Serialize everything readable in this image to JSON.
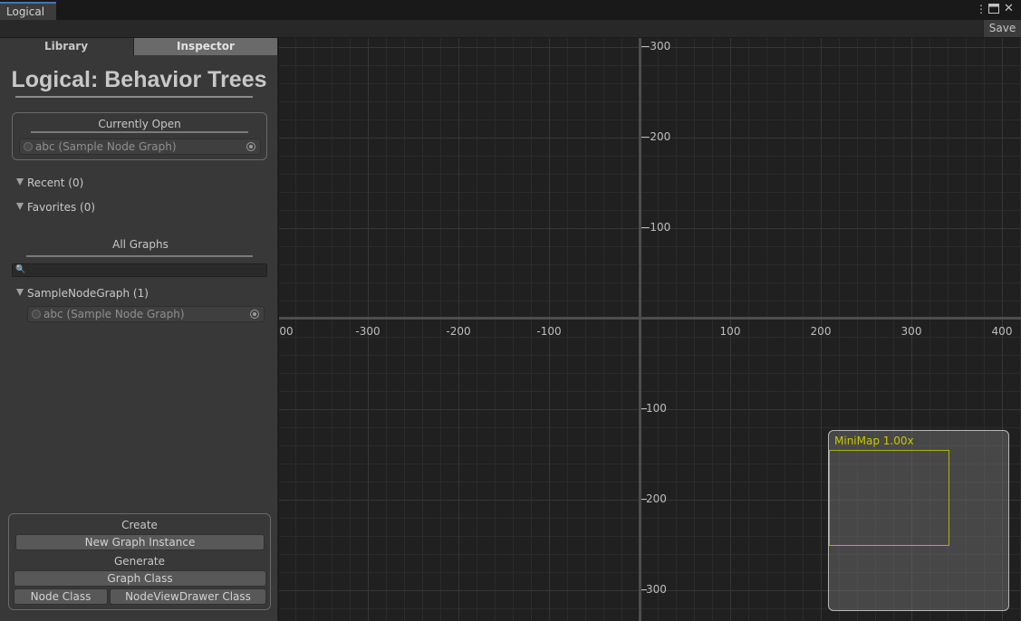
{
  "window": {
    "tab_title": "Logical",
    "menu_icon": "kebab-icon",
    "maximize_icon": "maximize-icon",
    "close_icon": "close-icon"
  },
  "toolbar": {
    "save_label": "Save"
  },
  "sidebar": {
    "tabs": [
      {
        "label": "Library",
        "active": true
      },
      {
        "label": "Inspector",
        "active": false
      }
    ],
    "title": "Logical: Behavior Trees",
    "currently_open": {
      "header": "Currently Open",
      "value": "abc (Sample Node Graph)"
    },
    "recent_label": "Recent (0)",
    "favorites_label": "Favorites (0)",
    "all_graphs": {
      "header": "All Graphs",
      "search_value": "",
      "groups": [
        {
          "label": "SampleNodeGraph (1)",
          "items": [
            "abc (Sample Node Graph)"
          ]
        }
      ]
    },
    "create": {
      "header": "Create",
      "new_instance_label": "New Graph Instance"
    },
    "generate": {
      "header": "Generate",
      "graph_class_label": "Graph Class",
      "node_class_label": "Node Class",
      "drawer_class_label": "NodeViewDrawer Class"
    }
  },
  "canvas": {
    "x_ticks": [
      "00",
      "-300",
      "-200",
      "-100",
      "100",
      "200",
      "300",
      "400"
    ],
    "y_ticks": [
      "-300",
      "-200",
      "-100",
      "100",
      "200",
      "300"
    ],
    "minimap_label": "MiniMap  1.00x"
  },
  "colors": {
    "accent": "#3a79bb",
    "minimap_text": "#c8c800",
    "panel_bg": "#383838",
    "canvas_bg": "#202020"
  }
}
